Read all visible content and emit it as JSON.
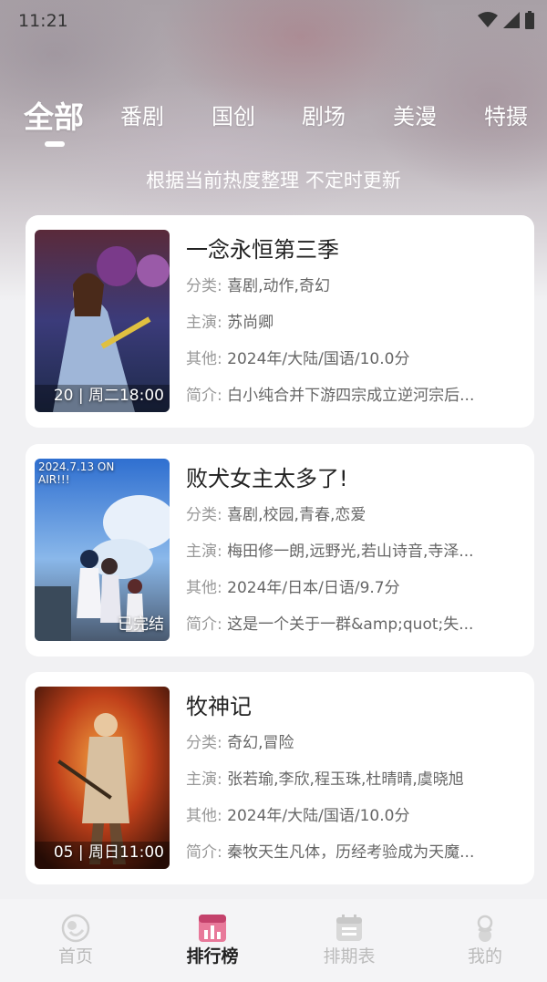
{
  "status_bar": {
    "time": "11:21"
  },
  "tabs": [
    {
      "label": "全部",
      "active": true
    },
    {
      "label": "番剧"
    },
    {
      "label": "国创"
    },
    {
      "label": "剧场"
    },
    {
      "label": "美漫"
    },
    {
      "label": "特摄"
    }
  ],
  "subtitle": "根据当前热度整理 不定时更新",
  "labels": {
    "category": "分类:",
    "cast": "主演:",
    "other": "其他:",
    "intro": "简介:"
  },
  "cards": [
    {
      "title": "一念永恒第三季",
      "badge": "20 | 周二18:00",
      "category": "喜剧,动作,奇幻",
      "cast": "苏尚卿",
      "other": "2024年/大陆/国语/10.0分",
      "intro": "白小纯合并下游四宗成立逆河宗后..."
    },
    {
      "title": "败犬女主太多了!",
      "badge": "已完结",
      "poster_text": "2024.7.13 ON AIR!!!",
      "category": "喜剧,校园,青春,恋爱",
      "cast": "梅田修一朗,远野光,若山诗音,寺泽...",
      "other": "2024年/日本/日语/9.7分",
      "intro": "这是一个关于一群&amp;quot;失..."
    },
    {
      "title": "牧神记",
      "badge": "05 | 周日11:00",
      "category": "奇幻,冒险",
      "cast": "张若瑜,李欣,程玉珠,杜晴晴,虞晓旭",
      "other": "2024年/大陆/国语/10.0分",
      "intro": "秦牧天生凡体，历经考验成为天魔..."
    }
  ],
  "bottom_nav": [
    {
      "label": "首页",
      "icon": "home-icon"
    },
    {
      "label": "排行榜",
      "icon": "ranking-icon",
      "active": true
    },
    {
      "label": "排期表",
      "icon": "calendar-icon"
    },
    {
      "label": "我的",
      "icon": "user-icon"
    }
  ],
  "colors": {
    "accent": "#e85a86",
    "card_bg": "#ffffff",
    "page_bg": "#f1f1f3"
  }
}
